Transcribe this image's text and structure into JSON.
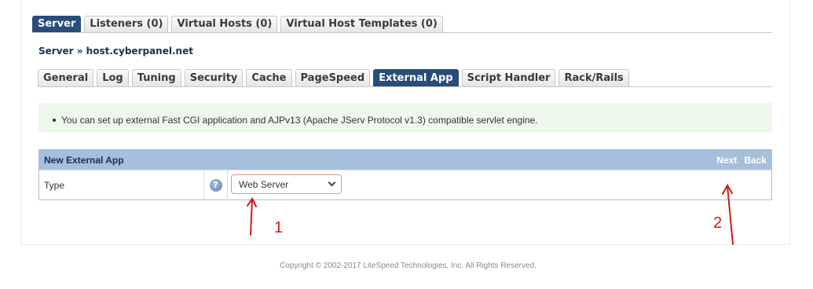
{
  "top_tabs": [
    {
      "label": "Server",
      "active": true
    },
    {
      "label": "Listeners (0)",
      "active": false
    },
    {
      "label": "Virtual Hosts (0)",
      "active": false
    },
    {
      "label": "Virtual Host Templates (0)",
      "active": false
    }
  ],
  "breadcrumb": "Server » host.cyberpanel.net",
  "sub_tabs": [
    {
      "label": "General",
      "active": false
    },
    {
      "label": "Log",
      "active": false
    },
    {
      "label": "Tuning",
      "active": false
    },
    {
      "label": "Security",
      "active": false
    },
    {
      "label": "Cache",
      "active": false
    },
    {
      "label": "PageSpeed",
      "active": false
    },
    {
      "label": "External App",
      "active": true
    },
    {
      "label": "Script Handler",
      "active": false
    },
    {
      "label": "Rack/Rails",
      "active": false
    }
  ],
  "info_message": "You can set up external Fast CGI application and AJPv13 (Apache JServ Protocol v1.3) compatible servlet engine.",
  "form": {
    "title": "New External App",
    "next_label": "Next",
    "back_label": "Back",
    "row_label": "Type",
    "help_glyph": "?",
    "type_value": "Web Server"
  },
  "annotations": {
    "label_1": "1",
    "label_2": "2",
    "color": "#d01818"
  },
  "icons": [
    "help-icon",
    "chevron-down-icon"
  ],
  "footer": "Copyright © 2002-2017 LiteSpeed Technologies, Inc. All Rights Reserved."
}
